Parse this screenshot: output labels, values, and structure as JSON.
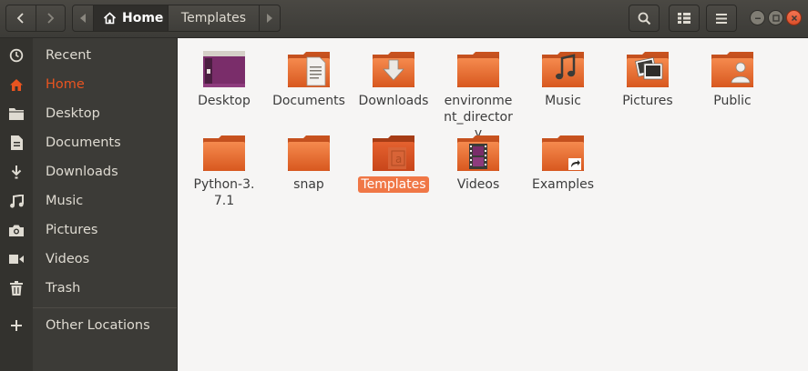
{
  "header": {
    "breadcrumb": {
      "home_label": "Home",
      "current_label": "Templates"
    }
  },
  "colors": {
    "accent": "#e95420",
    "selection": "#f07746",
    "sidebar_bg": "#3c3b37",
    "folder_orange": "#e86d3a"
  },
  "sidebar": {
    "items": [
      {
        "label": "Recent",
        "icon": "clock-icon"
      },
      {
        "label": "Home",
        "icon": "home-icon",
        "active": true
      },
      {
        "label": "Desktop",
        "icon": "folder-icon"
      },
      {
        "label": "Documents",
        "icon": "document-icon"
      },
      {
        "label": "Downloads",
        "icon": "download-icon"
      },
      {
        "label": "Music",
        "icon": "music-icon"
      },
      {
        "label": "Pictures",
        "icon": "camera-icon"
      },
      {
        "label": "Videos",
        "icon": "video-icon"
      },
      {
        "label": "Trash",
        "icon": "trash-icon"
      },
      {
        "label": "Other Locations",
        "icon": "plus-icon"
      }
    ]
  },
  "files": [
    {
      "label": "Desktop",
      "icon": "desktop-folder-icon"
    },
    {
      "label": "Documents",
      "icon": "documents-folder-icon"
    },
    {
      "label": "Downloads",
      "icon": "downloads-folder-icon"
    },
    {
      "label": "environment_directory",
      "icon": "folder-icon"
    },
    {
      "label": "Music",
      "icon": "music-folder-icon"
    },
    {
      "label": "Pictures",
      "icon": "pictures-folder-icon"
    },
    {
      "label": "Public",
      "icon": "public-folder-icon"
    },
    {
      "label": "Python-3.7.1",
      "icon": "folder-icon"
    },
    {
      "label": "snap",
      "icon": "folder-icon"
    },
    {
      "label": "Templates",
      "icon": "templates-folder-icon",
      "selected": true
    },
    {
      "label": "Videos",
      "icon": "videos-folder-icon"
    },
    {
      "label": "Examples",
      "icon": "link-folder-icon"
    }
  ]
}
